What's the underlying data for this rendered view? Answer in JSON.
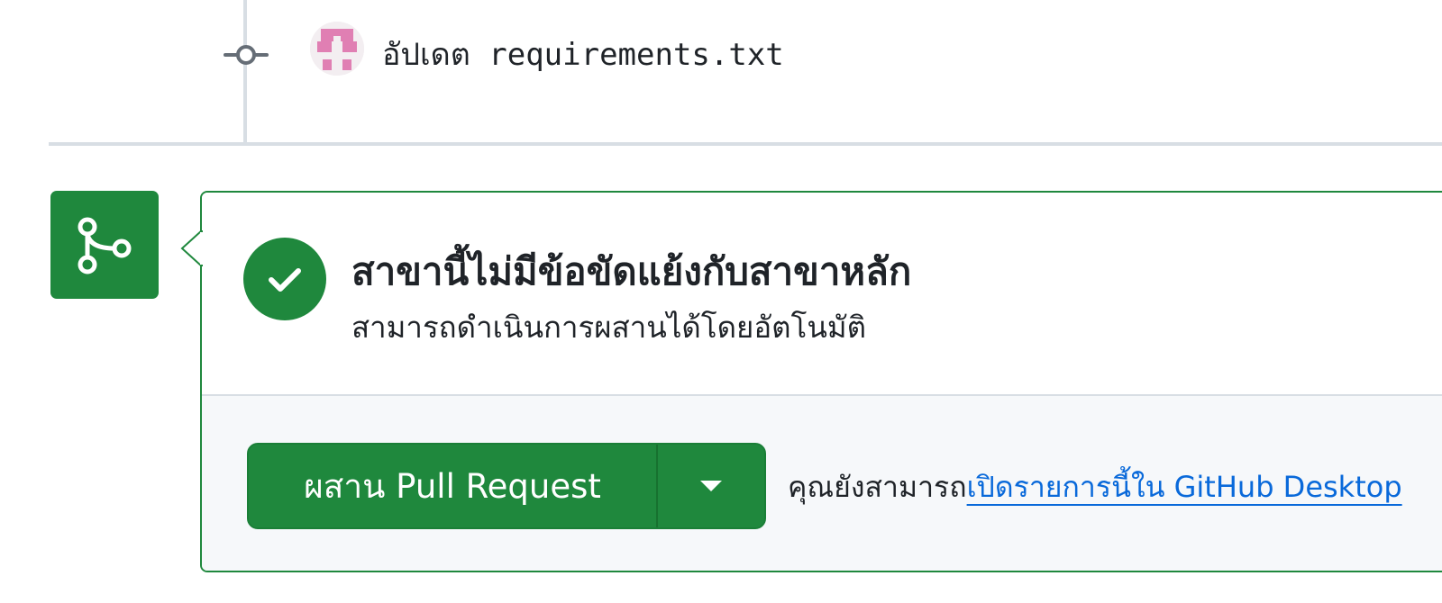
{
  "commit": {
    "message": "อัปเดต requirements.txt",
    "node_icon": "git-commit-icon",
    "avatar_icon": "identicon-avatar"
  },
  "merge_status": {
    "icon": "git-merge-icon",
    "check_icon": "check-icon",
    "title": "สาขานี้ไม่มีข้อขัดแย้งกับสาขาหลัก",
    "subtitle": "สามารถดำเนินการผสานได้โดยอัตโนมัติ"
  },
  "merge_actions": {
    "merge_button_label": "ผสาน Pull Request",
    "dropdown_icon": "triangle-down-icon",
    "alt_text": "คุณยังสามารถ",
    "alt_link": "เปิดรายการนี้ใน GitHub Desktop"
  },
  "colors": {
    "success_green": "#1f883d",
    "link_blue": "#0969da",
    "border_gray": "#d8dee4",
    "muted_bg": "#f6f8fa",
    "avatar_pink": "#e07fb3"
  }
}
